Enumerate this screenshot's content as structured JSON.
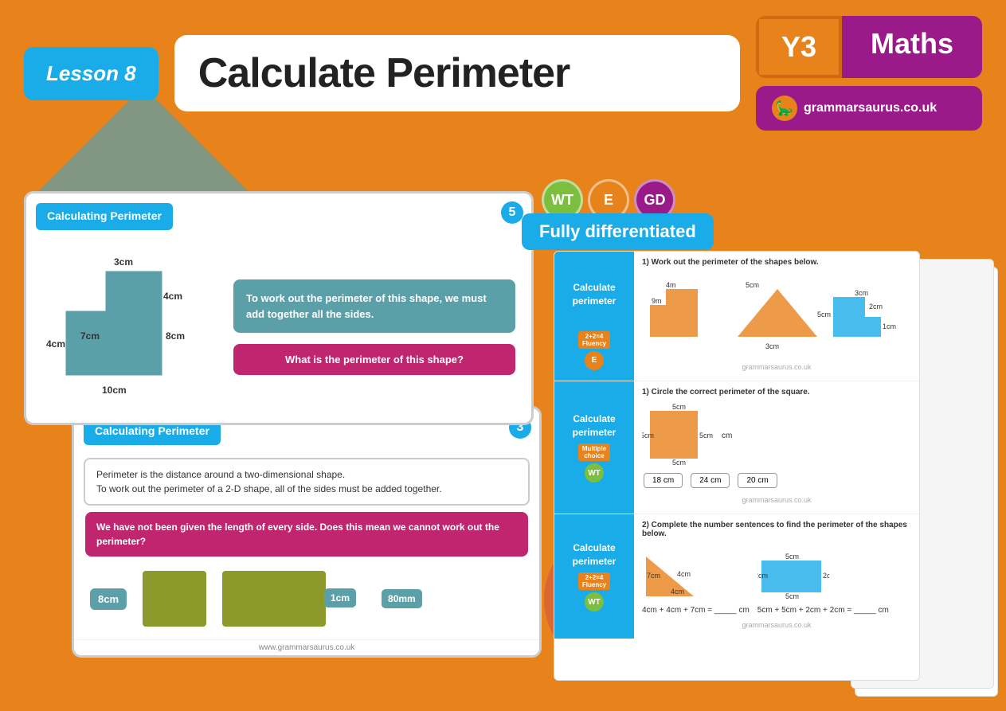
{
  "header": {
    "lesson_label": "Lesson 8",
    "title": "Calculate Perimeter",
    "year": "Y3",
    "subject": "Maths",
    "website": "grammarsaurus.co.uk"
  },
  "slide_front": {
    "title": "Calculating Perimeter",
    "number": "5",
    "info_text": "To work out the perimeter of this shape, we must add together all the sides.",
    "question": "What is the perimeter of this shape?",
    "measurements": {
      "top": "3cm",
      "right_top": "4cm",
      "middle": "7cm",
      "right_bottom": "8cm",
      "left": "4cm",
      "bottom": "10cm"
    }
  },
  "slide_back": {
    "title": "Calculating Perimeter",
    "number": "3",
    "text1": "Perimeter is the distance around a two-dimensional shape.\nTo work out the perimeter of a 2-D shape, all of the sides must be added together.",
    "text2": "We have not been given the length of every side. Does this mean we cannot work out the perimeter?",
    "label1": "8cm",
    "label2": "1cm",
    "label3": "80mm",
    "footer": "www.grammarsaurus.co.uk"
  },
  "differentiation": {
    "badges": [
      "WT",
      "E",
      "GD"
    ],
    "banner": "Fully differentiated"
  },
  "worksheet": {
    "sections": [
      {
        "left_title": "Calculate\nperimeter",
        "task": "1) Work out the perimeter of the shapes below.",
        "type": "fluency",
        "level": "E",
        "footer": "grammarsaurus.co.uk"
      },
      {
        "left_title": "Calculate\nperimeter",
        "task": "1) Circle the correct perimeter of the square.",
        "type": "multiple_choice",
        "level": "WT",
        "choices": [
          "18 cm",
          "24 cm",
          "20 cm"
        ],
        "shape_label": "5cm",
        "footer": "grammarsaurus.co.uk"
      },
      {
        "left_title": "Calculate\nperimeter",
        "task": "2) Complete the number sentences to find the perimeter of the shapes below.",
        "type": "fluency",
        "level": "WT",
        "formula1": "4cm + 4cm + 7cm = _____ cm",
        "formula2": "5cm + 5cm + 2cm + 2cm = _____ cm",
        "footer": "grammarsaurus.co.uk"
      }
    ]
  }
}
